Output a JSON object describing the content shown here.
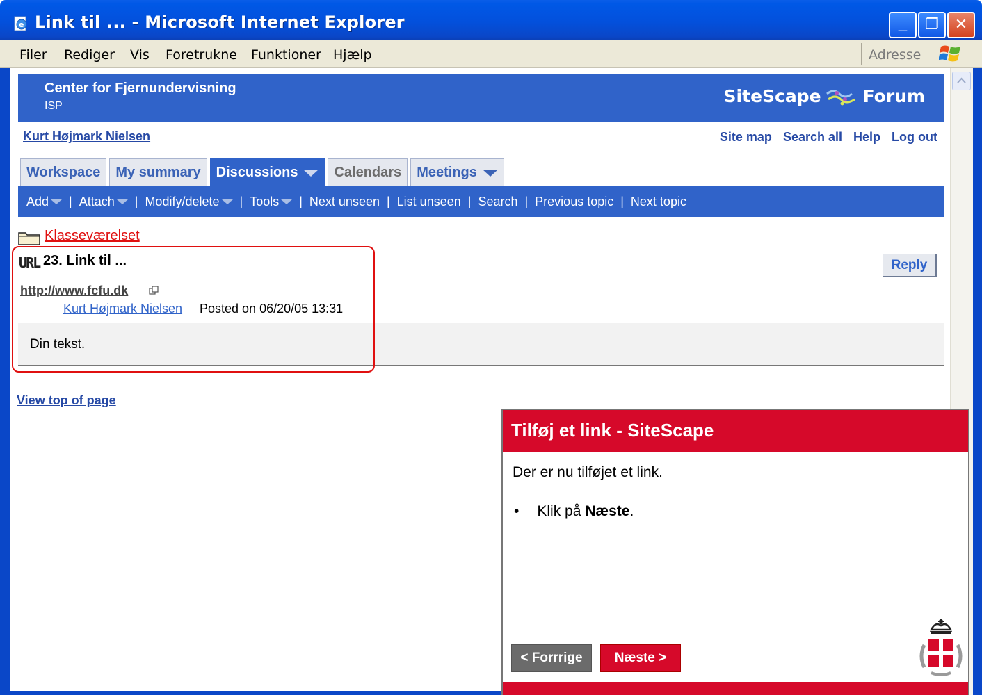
{
  "window": {
    "title": "Link til ... - Microsoft Internet Explorer",
    "min_label": "_",
    "max_label": "❐",
    "close_label": "✕"
  },
  "menubar": {
    "items": [
      "Filer",
      "Rediger",
      "Vis",
      "Foretrukne",
      "Funktioner",
      "Hjælp"
    ],
    "address_label": "Adresse"
  },
  "site": {
    "org_name": "Center for Fjernundervisning",
    "org_sub": "ISP",
    "logo_left": "SiteScape",
    "logo_right": "Forum",
    "user_name": "Kurt Højmark Nielsen",
    "top_links": [
      "Site map",
      "Search all",
      "Help",
      "Log out"
    ]
  },
  "tabs": [
    {
      "label": "Workspace"
    },
    {
      "label": "My summary"
    },
    {
      "label": "Discussions"
    },
    {
      "label": "Calendars"
    },
    {
      "label": "Meetings"
    }
  ],
  "toolbar": {
    "items": [
      "Add",
      "Attach",
      "Modify/delete",
      "Tools",
      "Next unseen",
      "List unseen",
      "Search",
      "Previous topic",
      "Next topic"
    ],
    "separator": "|"
  },
  "content": {
    "folder_link": "Klasseværelset",
    "url_icon": "URL",
    "topic_title": "23. Link til ...",
    "reply_label": "Reply",
    "topic_url": "http://www.fcfu.dk",
    "author": "Kurt Højmark Nielsen",
    "posted": "Posted on 06/20/05 13:31",
    "body": "Din tekst.",
    "view_top": "View top of page"
  },
  "popup": {
    "title": "Tilføj et link - SiteScape",
    "text": "Der er nu tilføjet et link.",
    "bullet_prefix": "Klik på ",
    "bullet_bold": "Næste",
    "bullet_suffix": ".",
    "prev_label": "< Forrrige",
    "next_label": "Næste >"
  },
  "colors": {
    "ie_blue": "#0a47c8",
    "header_blue": "#3063c9",
    "link_blue": "#2649a5",
    "accent_red": "#d6092a",
    "highlight_red": "#e01010"
  },
  "icons": {
    "app": "ie-page-icon",
    "folder": "folder-icon",
    "external": "external-link-icon",
    "crest": "crown-crest-icon",
    "windows_flag": "windows-flag-icon"
  }
}
